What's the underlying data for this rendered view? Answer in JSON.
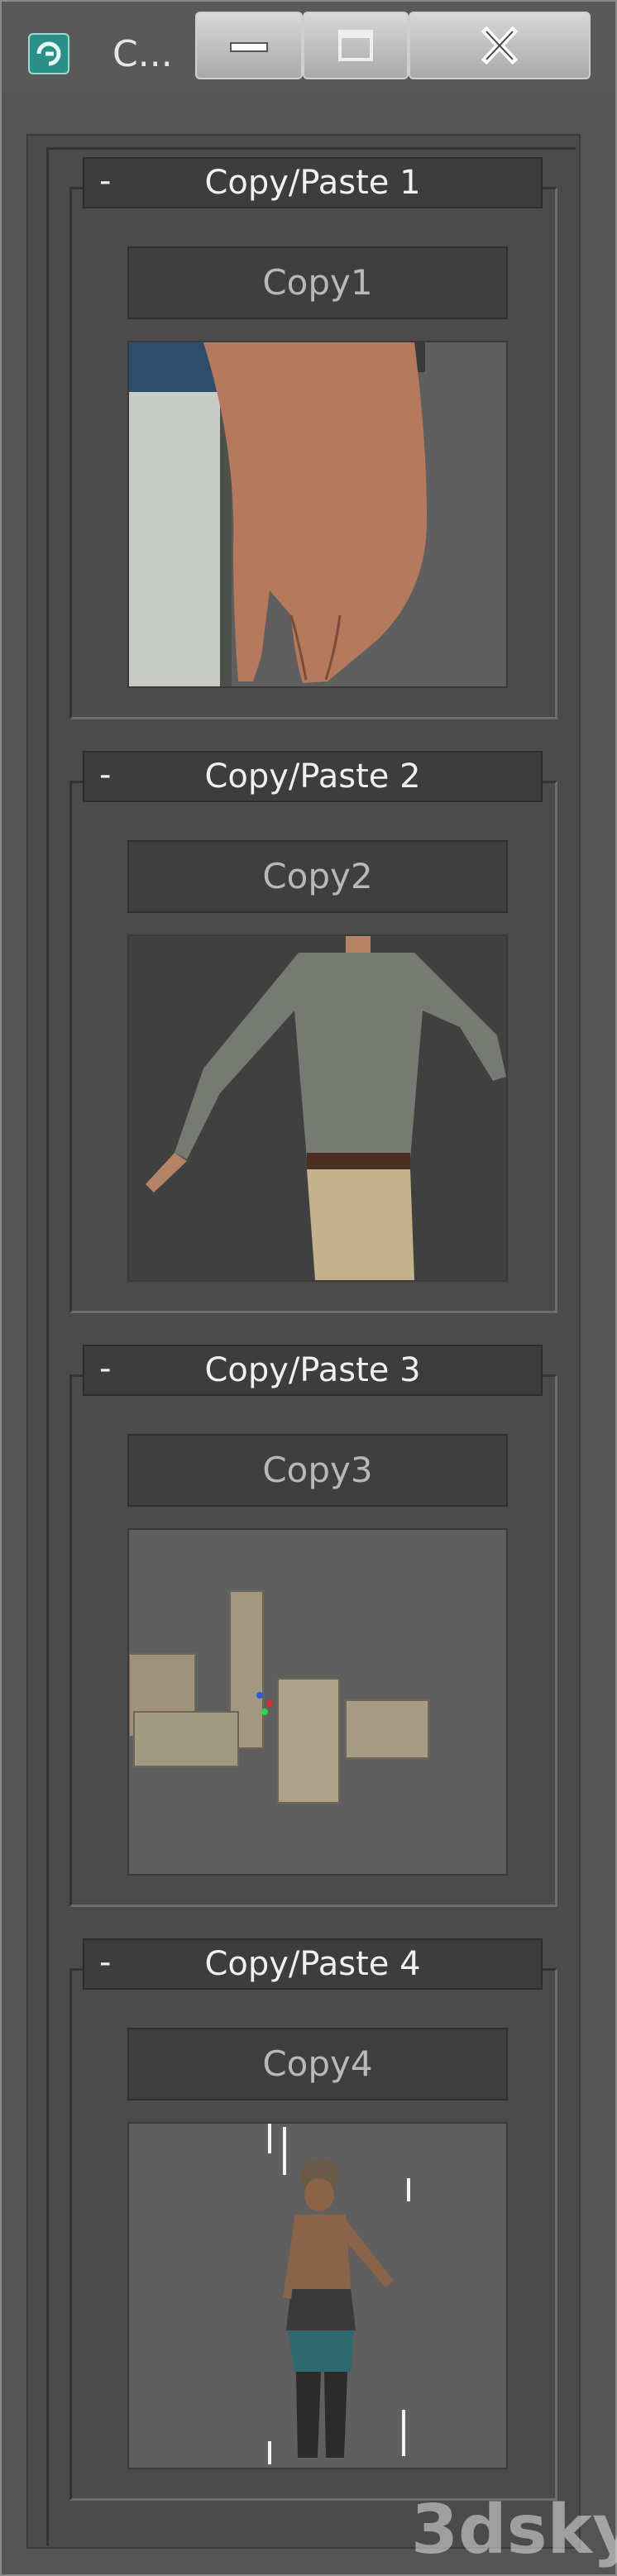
{
  "window": {
    "title": "C...",
    "minimize_icon": "minimize-icon",
    "maximize_icon": "maximize-icon",
    "close_icon": "close-icon"
  },
  "rollouts": [
    {
      "collapse": "-",
      "title": "Copy/Paste 1",
      "button": "Copy1",
      "thumbnail": "hand-thumbnail"
    },
    {
      "collapse": "-",
      "title": "Copy/Paste 2",
      "button": "Copy2",
      "thumbnail": "man-thumbnail"
    },
    {
      "collapse": "-",
      "title": "Copy/Paste 3",
      "button": "Copy3",
      "thumbnail": "ruins-thumbnail"
    },
    {
      "collapse": "-",
      "title": "Copy/Paste 4",
      "button": "Copy4",
      "thumbnail": "warrior-thumbnail"
    }
  ],
  "watermark": "3dsky"
}
